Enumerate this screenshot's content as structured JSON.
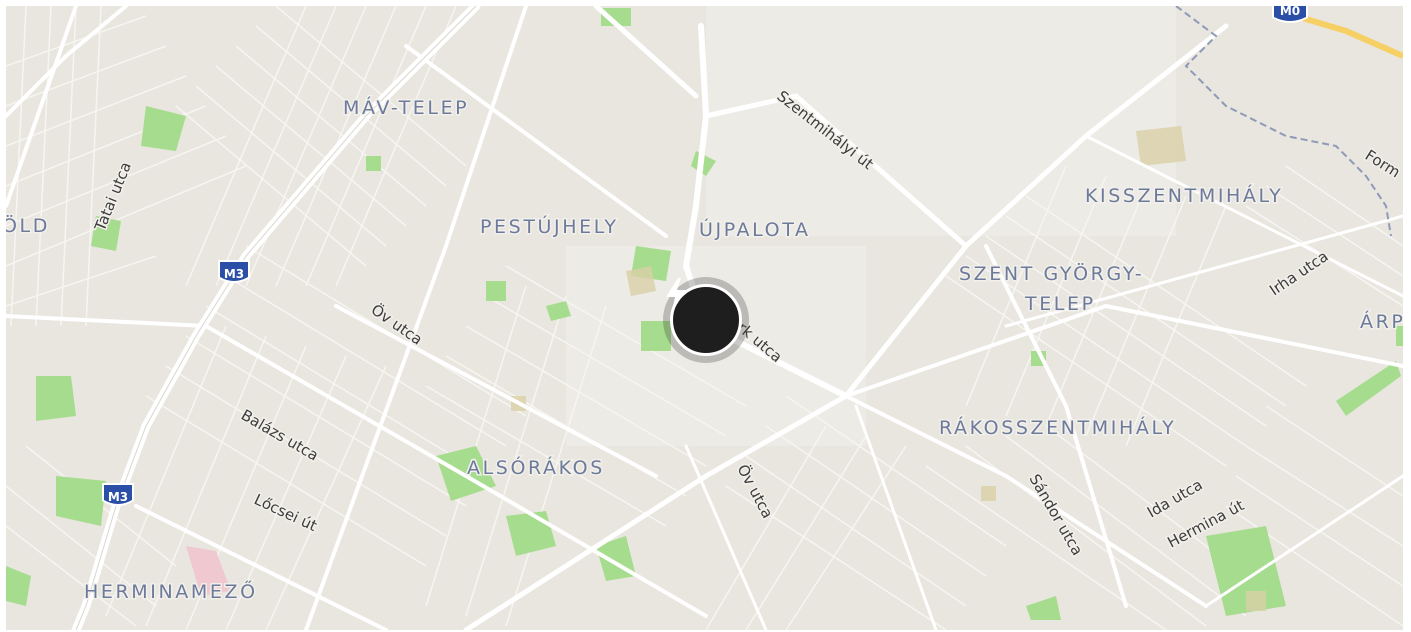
{
  "map": {
    "districts": {
      "mav_telep": "MÁV-TELEP",
      "pestujhely": "PESTÚJHELY",
      "ujpalota": "ÚJPALOTA",
      "kisszentmihaly": "KISSZENTMIHÁLY",
      "szent_gyorgy_telep_1": "SZENT GYÖRGY-",
      "szent_gyorgy_telep_2": "TELEP",
      "rakosszentmihaly": "RÁKOSSZENTMIHÁLY",
      "alsorakos": "ALSÓRÁKOS",
      "herminamezo": "HERMINAMEZŐ",
      "old_partial": "ÖLD",
      "arp_partial": "ÁRP"
    },
    "streets": {
      "tatai_utca": "Tatai utca",
      "ov_utca_1": "Öv utca",
      "ov_utca_2": "Öv utca",
      "szentmihalyi_ut": "Szentmihályi út",
      "park_utca": "Park utca",
      "irha_utca": "Irha utca",
      "balazs_utca": "Balázs utca",
      "locsei_ut": "Lőcsei út",
      "sandor_utca": "Sándor utca",
      "ida_utca": "Ida utca",
      "hermina_ut": "Hermina út",
      "form_partial": "Form"
    },
    "shields": {
      "m3_top": "M3",
      "m3_bottom": "M3",
      "m0_partial": "M0"
    },
    "marker": {
      "icon": "lightning-bolt-icon"
    },
    "colors": {
      "land": "#e9e6df",
      "road": "#ffffff",
      "park": "#a6dc8e",
      "district_label": "#6d7a9b",
      "motorway": "#f6cf65",
      "shield": "#2b4fa7",
      "marker": "#1e1e1e",
      "boundary": "#8f99b8"
    }
  }
}
